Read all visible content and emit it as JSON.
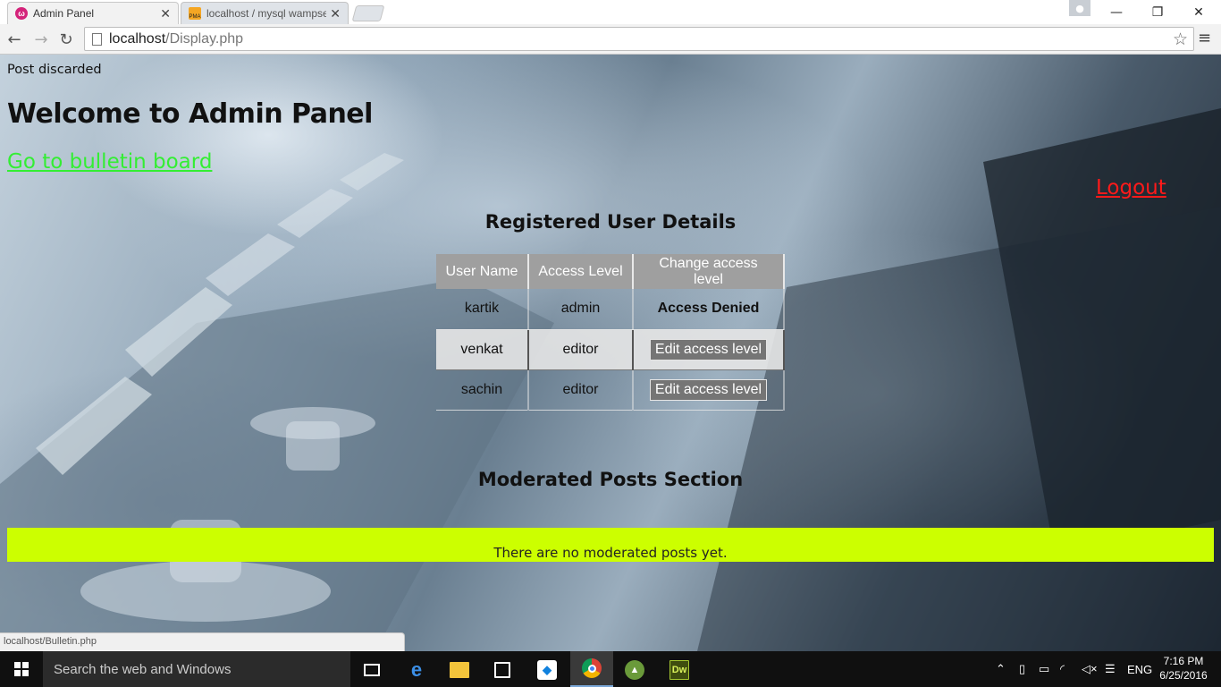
{
  "browser": {
    "tabs": [
      {
        "title": "Admin Panel",
        "active": true,
        "favicon": "admin-panel-icon"
      },
      {
        "title": "localhost / mysql wampse",
        "active": false,
        "favicon": "phpmyadmin-icon"
      }
    ],
    "url_host": "localhost",
    "url_path": "/Display.php",
    "status_url": "localhost/Bulletin.php",
    "favicon_pma_text": "PMA"
  },
  "page": {
    "message": "Post discarded",
    "heading": "Welcome to Admin Panel",
    "bulletin_link": "Go to bulletin board",
    "logout_link": "Logout",
    "users_section_title": "Registered User Details",
    "users_table": {
      "headers": [
        "User Name",
        "Access Level",
        "Change access level"
      ],
      "rows": [
        {
          "username": "kartik",
          "access": "admin",
          "action": "Access Denied"
        },
        {
          "username": "venkat",
          "access": "editor",
          "action": "Edit access level"
        },
        {
          "username": "sachin",
          "access": "editor",
          "action": "Edit access level"
        }
      ]
    },
    "moderated_section_title": "Moderated Posts Section",
    "no_posts_message": "There are no moderated posts yet.",
    "colors": {
      "bulletin_link": "#33ee33",
      "logout_link": "#ff1a1a",
      "posts_bar": "#ccff00",
      "table_header": "#9f9f9f"
    }
  },
  "taskbar": {
    "search_placeholder": "Search the web and Windows",
    "apps": [
      "task-view-icon",
      "edge-icon",
      "file-explorer-icon",
      "store-icon",
      "dropbox-icon",
      "chrome-icon",
      "android-studio-icon",
      "dreamweaver-icon"
    ],
    "dreamweaver_label": "Dw",
    "language": "ENG",
    "time": "7:16 PM",
    "date": "6/25/2016"
  }
}
